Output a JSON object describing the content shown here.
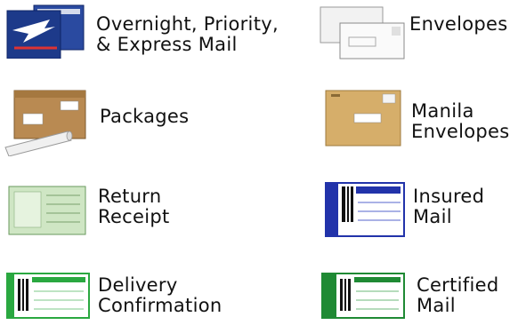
{
  "items": [
    {
      "name": "overnight-priority-express",
      "lines": [
        "Overnight, Priority,",
        "& Express Mail"
      ],
      "icon": "usps-eagle-boxes-icon"
    },
    {
      "name": "envelopes",
      "lines": [
        "Envelopes"
      ],
      "icon": "white-envelopes-icon"
    },
    {
      "name": "packages",
      "lines": [
        "Packages"
      ],
      "icon": "cardboard-box-tube-icon"
    },
    {
      "name": "manila-envelopes",
      "lines": [
        "Manila",
        "Envelopes"
      ],
      "icon": "manila-envelope-icon"
    },
    {
      "name": "return-receipt",
      "lines": [
        "Return",
        "Receipt"
      ],
      "icon": "green-receipt-card-icon"
    },
    {
      "name": "insured-mail",
      "lines": [
        "Insured",
        "Mail"
      ],
      "icon": "insured-mail-form-icon"
    },
    {
      "name": "delivery-confirmation",
      "lines": [
        "Delivery",
        "Confirmation"
      ],
      "icon": "delivery-confirmation-label-icon"
    },
    {
      "name": "certified-mail",
      "lines": [
        "Certified",
        "Mail"
      ],
      "icon": "certified-mail-label-icon"
    }
  ],
  "colors": {
    "usps_blue": "#1d3a8a",
    "cardboard": "#b98a52",
    "manila": "#d6ae6a",
    "receipt_green": "#cfe6c4",
    "insured_blue": "#2233aa",
    "label_green": "#2aa840"
  }
}
